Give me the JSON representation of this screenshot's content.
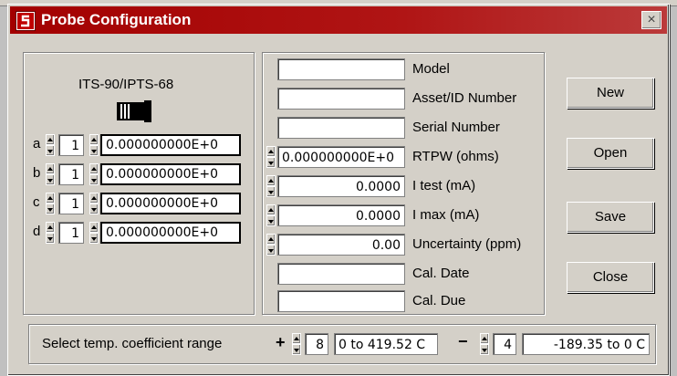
{
  "window": {
    "title": "Probe Configuration",
    "close_glyph": "×"
  },
  "left_panel": {
    "scale_label": "ITS-90/IPTS-68",
    "coefficients": [
      {
        "name": "a",
        "index": "1",
        "value": "0.000000000E+0"
      },
      {
        "name": "b",
        "index": "1",
        "value": "0.000000000E+0"
      },
      {
        "name": "c",
        "index": "1",
        "value": "0.000000000E+0"
      },
      {
        "name": "d",
        "index": "1",
        "value": "0.000000000E+0"
      }
    ]
  },
  "probe_fields": [
    {
      "label": "Model",
      "value": ""
    },
    {
      "label": "Asset/ID Number",
      "value": ""
    },
    {
      "label": "Serial Number",
      "value": ""
    },
    {
      "label": "RTPW (ohms)",
      "value": "0.000000000E+0"
    },
    {
      "label": "I test (mA)",
      "value": "0.0000"
    },
    {
      "label": "I max (mA)",
      "value": "0.0000"
    },
    {
      "label": "Uncertainty (ppm)",
      "value": "0.00"
    },
    {
      "label": "Cal. Date",
      "value": ""
    },
    {
      "label": "Cal. Due",
      "value": ""
    }
  ],
  "buttons": {
    "new": "New",
    "open": "Open",
    "save": "Save",
    "close": "Close"
  },
  "range": {
    "label": "Select temp. coefficient range",
    "plus_sign": "+",
    "plus_index": "8",
    "plus_range": "0 to 419.52 C",
    "minus_sign": "−",
    "minus_index": "4",
    "minus_range": "-189.35 to 0 C"
  },
  "colors": {
    "title_bar": "#a30000",
    "face": "#d4d0c8"
  }
}
